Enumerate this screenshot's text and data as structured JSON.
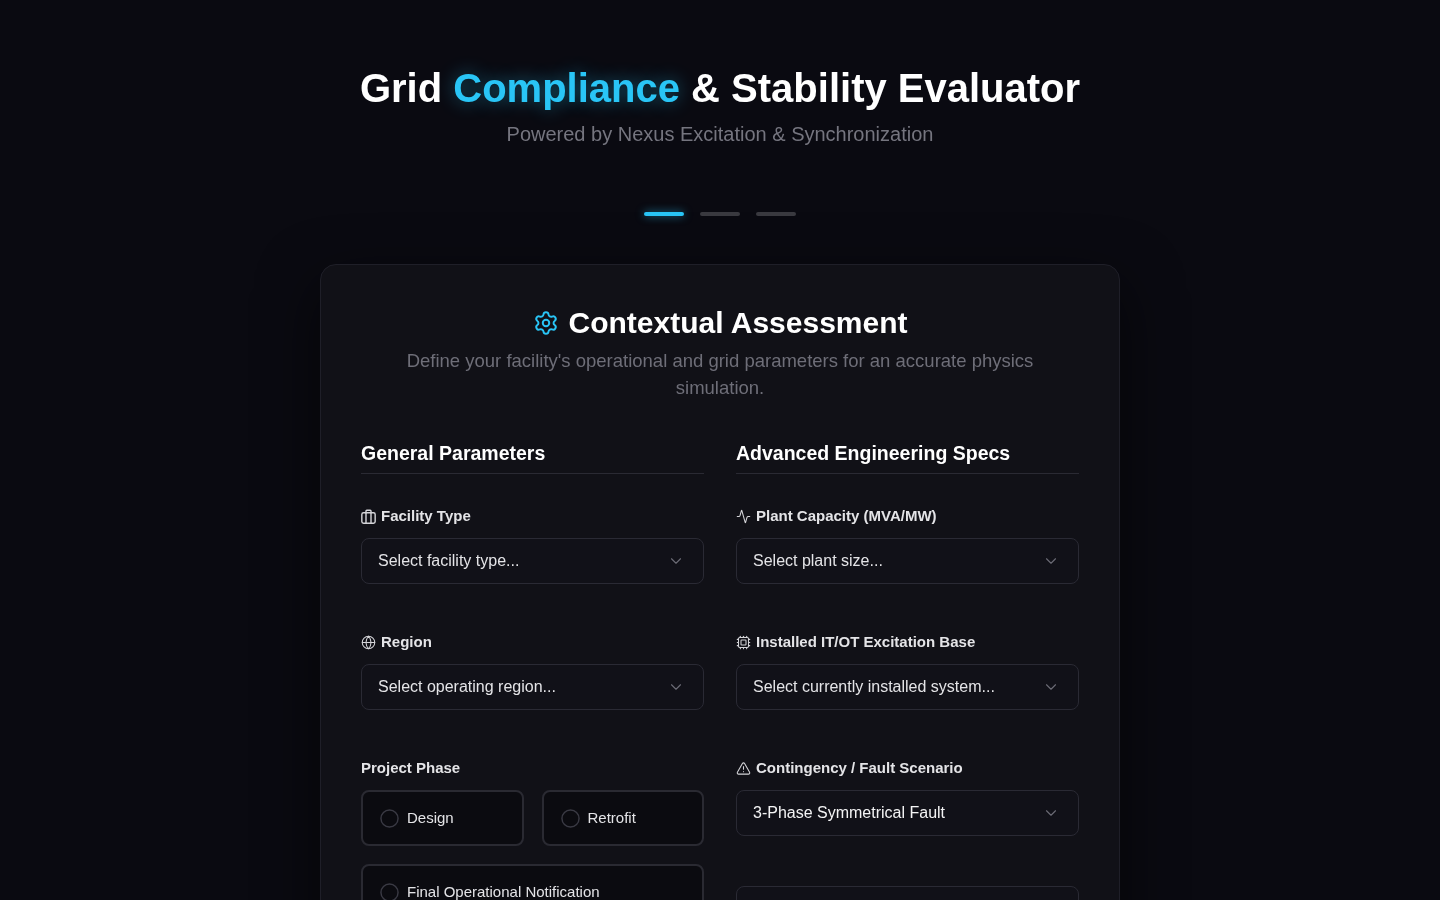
{
  "header": {
    "title_parts": [
      {
        "text": "Grid",
        "accent": false
      },
      {
        "text": "Compliance",
        "accent": true
      },
      {
        "text": "& Stability Evaluator",
        "accent": false
      }
    ],
    "subtitle": "Powered by Nexus Excitation & Synchronization"
  },
  "steps": [
    {
      "selected": true
    },
    {
      "selected": false
    },
    {
      "selected": false
    }
  ],
  "card": {
    "title": "Contextual Assessment",
    "description": "Define your facility's operational and grid parameters for an accurate physics simulation.",
    "columns": [
      {
        "heading": "General Parameters",
        "fields": [
          {
            "kind": "select",
            "label": "Facility Type",
            "placeholder": "Select facility type..."
          },
          {
            "kind": "select",
            "label": "Region",
            "placeholder": "Select operating region..."
          },
          {
            "kind": "radio_group",
            "label": "Project Phase",
            "options": [
              {
                "label": "Design",
                "selected": false
              },
              {
                "label": "Retrofit",
                "selected": false
              },
              {
                "label": "Final Operational Notification",
                "selected": false
              }
            ]
          }
        ]
      },
      {
        "heading": "Advanced Engineering Specs",
        "fields": [
          {
            "kind": "select",
            "label": "Plant Capacity (MVA/MW)",
            "placeholder": "Select plant size..."
          },
          {
            "kind": "select",
            "label": "Installed IT/OT Excitation Base",
            "placeholder": "Select currently installed system..."
          },
          {
            "kind": "select",
            "label": "Contingency / Fault Scenario",
            "value": "3-Phase Symmetrical Fault"
          },
          {
            "kind": "blank"
          }
        ]
      }
    ]
  }
}
